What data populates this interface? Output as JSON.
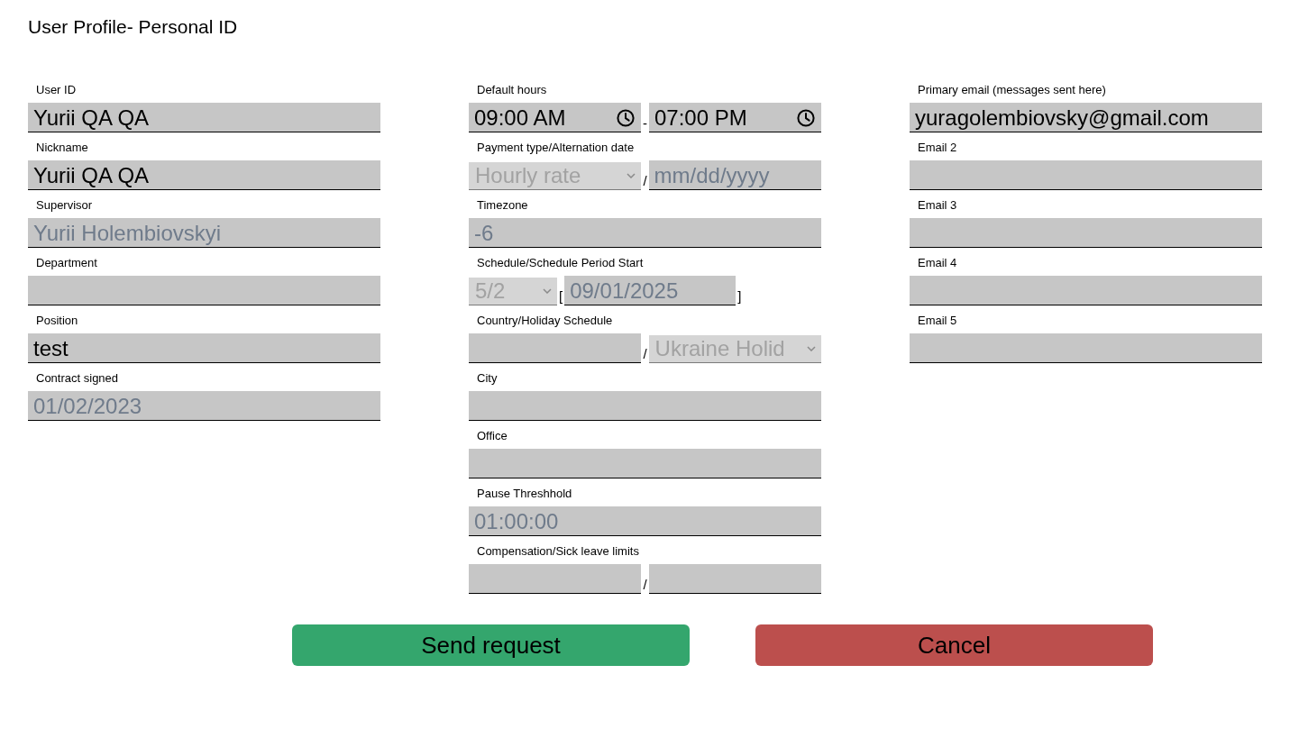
{
  "title": "User Profile- Personal ID",
  "columns": [
    {
      "fields": [
        {
          "label": "User ID",
          "parts": [
            {
              "kind": "text",
              "value": "Yurii QA QA",
              "disabled": false
            }
          ]
        },
        {
          "label": "Nickname",
          "parts": [
            {
              "kind": "text",
              "value": "Yurii QA QA",
              "disabled": false
            }
          ]
        },
        {
          "label": "Supervisor",
          "parts": [
            {
              "kind": "text",
              "value": "Yurii Holembiovskyi",
              "disabled": true
            }
          ]
        },
        {
          "label": "Department",
          "parts": [
            {
              "kind": "text"
            }
          ]
        },
        {
          "label": "Position",
          "parts": [
            {
              "kind": "text",
              "value": "test",
              "disabled": false
            }
          ]
        },
        {
          "label": "Contract signed",
          "parts": [
            {
              "kind": "date",
              "value": "01/02/2023",
              "disabled": true
            }
          ]
        }
      ]
    },
    {
      "fields": [
        {
          "label": "Default hours",
          "parts": [
            {
              "kind": "time",
              "value": "09:00 AM",
              "disabled": false
            },
            {
              "kind": "separator",
              "text": "-"
            },
            {
              "kind": "time",
              "value": "07:00 PM",
              "disabled": false
            }
          ]
        },
        {
          "label": "Payment type/Alternation date",
          "parts": [
            {
              "kind": "select",
              "value": "Hourly rate",
              "disabled": true
            },
            {
              "kind": "separator",
              "text": "/"
            },
            {
              "kind": "date",
              "placeholder": "mm/dd/yyyy"
            }
          ]
        },
        {
          "label": "Timezone",
          "parts": [
            {
              "kind": "text",
              "value": "-6",
              "disabled": true
            }
          ]
        },
        {
          "label": "Schedule/Schedule Period Start",
          "parts": [
            {
              "kind": "select",
              "value": "5/2",
              "disabled": true
            },
            {
              "kind": "separator",
              "text": "["
            },
            {
              "kind": "date",
              "value": "09/01/2025",
              "disabled": true
            },
            {
              "kind": "separator",
              "text": "]"
            }
          ]
        },
        {
          "label": "Country/Holiday Schedule",
          "parts": [
            {
              "kind": "text"
            },
            {
              "kind": "separator",
              "text": "/"
            },
            {
              "kind": "select",
              "value": "Ukraine Holid",
              "disabled": true
            }
          ]
        },
        {
          "label": "City",
          "parts": [
            {
              "kind": "text"
            }
          ]
        },
        {
          "label": "Office",
          "parts": [
            {
              "kind": "text"
            }
          ]
        },
        {
          "label": "Pause Threshhold",
          "parts": [
            {
              "kind": "time",
              "value": "01:00:00",
              "disabled": true
            }
          ]
        },
        {
          "label": "Compensation/Sick leave limits",
          "parts": [
            {
              "kind": "text"
            },
            {
              "kind": "separator",
              "text": "/"
            },
            {
              "kind": "text"
            }
          ]
        }
      ]
    },
    {
      "fields": [
        {
          "label": "Primary email (messages sent here)",
          "parts": [
            {
              "kind": "text",
              "value": "yuragolembiovsky@gmail.com",
              "disabled": false
            }
          ]
        },
        {
          "label": "Email 2",
          "parts": [
            {
              "kind": "text"
            }
          ]
        },
        {
          "label": "Email 3",
          "parts": [
            {
              "kind": "text"
            }
          ]
        },
        {
          "label": "Email 4",
          "parts": [
            {
              "kind": "text"
            }
          ]
        },
        {
          "label": "Email 5",
          "parts": [
            {
              "kind": "text"
            }
          ]
        }
      ]
    }
  ],
  "buttons": [
    {
      "label": "Send request",
      "kind": "submit"
    },
    {
      "label": "Cancel",
      "kind": "cancel"
    }
  ]
}
